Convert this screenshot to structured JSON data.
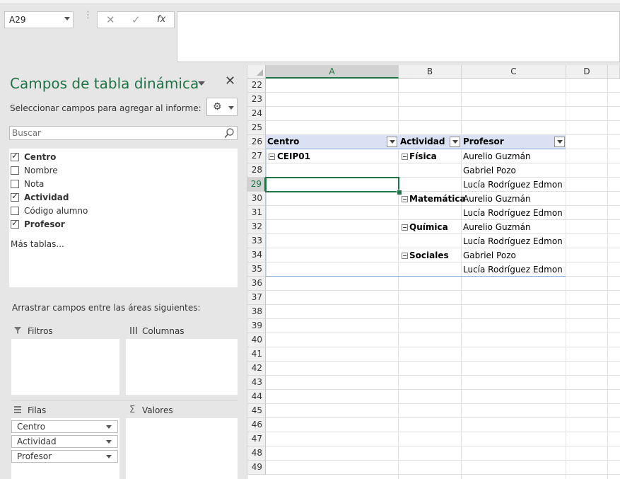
{
  "name_box": {
    "value": "A29"
  },
  "formula_bar": {
    "cancel_icon": "✕",
    "enter_icon": "✓",
    "function_icon": "fx",
    "content": ""
  },
  "pane": {
    "title": "Campos de tabla dinámica",
    "close": "✕",
    "subtitle": "Seleccionar campos para agregar al informe:",
    "search_placeholder": "Buscar",
    "fields": [
      {
        "label": "Centro",
        "checked": true
      },
      {
        "label": "Nombre",
        "checked": false
      },
      {
        "label": "Nota",
        "checked": false
      },
      {
        "label": "Actividad",
        "checked": true
      },
      {
        "label": "Código alumno",
        "checked": false
      },
      {
        "label": "Profesor",
        "checked": true
      }
    ],
    "more_tables": "Más tablas...",
    "drag_label": "Arrastrar campos entre las áreas siguientes:",
    "areas": {
      "filters": "Filtros",
      "columns": "Columnas",
      "rows": "Filas",
      "values": "Valores"
    },
    "row_fields": [
      "Centro",
      "Actividad",
      "Profesor"
    ]
  },
  "grid": {
    "columns": [
      "A",
      "B",
      "C",
      "D"
    ],
    "rows": [
      "22",
      "23",
      "24",
      "25",
      "26",
      "27",
      "28",
      "29",
      "30",
      "31",
      "32",
      "33",
      "34",
      "35",
      "36",
      "37",
      "38",
      "39",
      "40",
      "41",
      "42",
      "43",
      "44",
      "45",
      "46",
      "47",
      "48",
      "49"
    ],
    "active_row": "29",
    "active_column": "A",
    "pivot_headers": [
      "Centro",
      "Actividad",
      "Profesor"
    ],
    "pivot": {
      "centro": "CEIP01",
      "activities": [
        {
          "name": "Física",
          "teachers": [
            "Aurelio Guzmán",
            "Gabriel Pozo",
            "Lucía Rodríguez Edmon"
          ]
        },
        {
          "name": "Matemática",
          "teachers": [
            "Aurelio Guzmán",
            "Lucía Rodríguez Edmon"
          ]
        },
        {
          "name": "Química",
          "teachers": [
            "Aurelio Guzmán",
            "Lucía Rodríguez Edmon"
          ]
        },
        {
          "name": "Sociales",
          "teachers": [
            "Gabriel Pozo",
            "Lucía Rodríguez Edmon"
          ]
        }
      ]
    }
  }
}
